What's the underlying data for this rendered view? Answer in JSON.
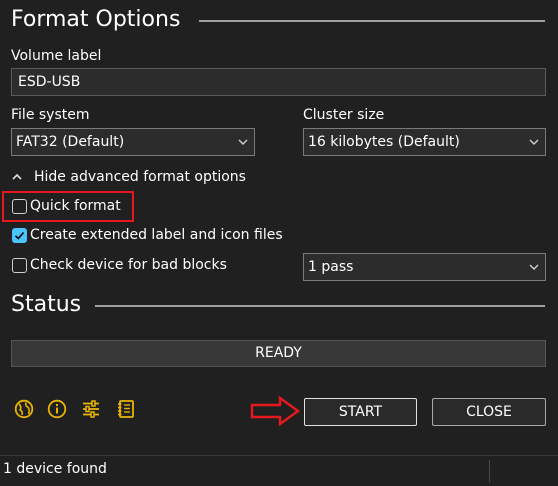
{
  "format_options": {
    "title": "Format Options",
    "volume_label": {
      "label": "Volume label",
      "value": "ESD-USB"
    },
    "file_system": {
      "label": "File system",
      "value": "FAT32 (Default)"
    },
    "cluster_size": {
      "label": "Cluster size",
      "value": "16 kilobytes (Default)"
    },
    "advanced_toggle": "Hide advanced format options",
    "quick_format": {
      "label": "Quick format",
      "checked": false
    },
    "extended_label": {
      "label": "Create extended label and icon files",
      "checked": true
    },
    "bad_blocks": {
      "label": "Check device for bad blocks",
      "checked": false,
      "passes": "1 pass"
    }
  },
  "status": {
    "title": "Status",
    "progress_text": "READY",
    "progress_value": 0
  },
  "actions": {
    "start": "START",
    "close": "CLOSE",
    "icons": [
      "globe-icon",
      "info-icon",
      "settings-sliders-icon",
      "log-icon"
    ]
  },
  "status_bar": {
    "text": "1 device found"
  },
  "colors": {
    "background": "#202020",
    "checkbox_accent": "#4cc2ff",
    "tool_icon": "#e8b400",
    "annotation_red": "#e8191e"
  }
}
